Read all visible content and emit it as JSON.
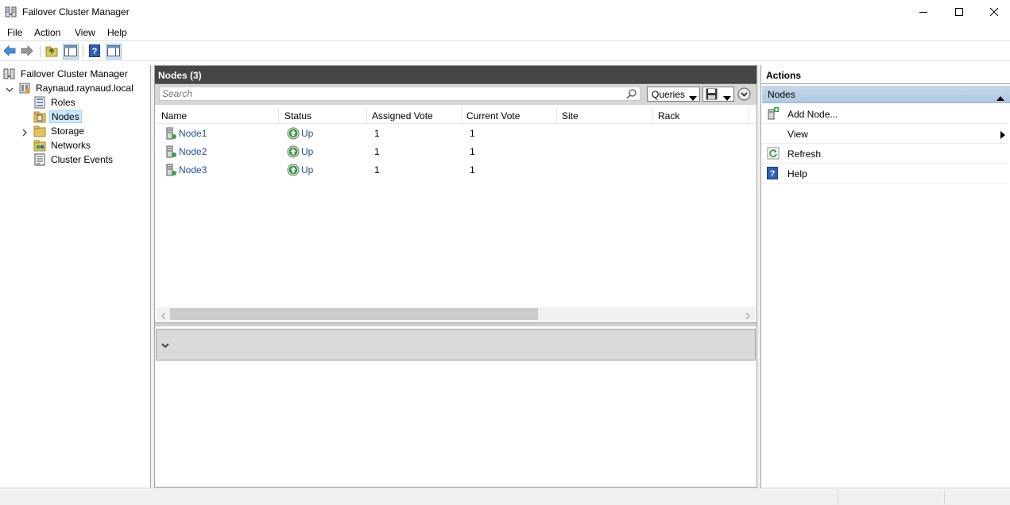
{
  "window": {
    "title": "Failover Cluster Manager",
    "controls": [
      "minimize-icon",
      "maximize-icon",
      "close-icon"
    ]
  },
  "menu": [
    "File",
    "Action",
    "View",
    "Help"
  ],
  "toolbar": {
    "buttons": [
      "back-arrow-icon",
      "forward-arrow-icon",
      "up-folder-icon",
      "show-hide-console-tree-icon",
      "help-icon",
      "show-hide-action-pane-icon"
    ]
  },
  "tree": {
    "root": "Failover Cluster Manager",
    "cluster": "Raynaud.raynaud.local",
    "children": [
      "Roles",
      "Nodes",
      "Storage",
      "Networks",
      "Cluster Events"
    ],
    "selected": "Nodes"
  },
  "center": {
    "title": "Nodes (3)",
    "search_placeholder": "Search",
    "queries_label": "Queries",
    "columns": [
      "Name",
      "Status",
      "Assigned Vote",
      "Current Vote",
      "Site",
      "Rack"
    ],
    "rows": [
      {
        "name": "Node1",
        "status": "Up",
        "assigned_vote": "1",
        "current_vote": "1",
        "site": "",
        "rack": ""
      },
      {
        "name": "Node2",
        "status": "Up",
        "assigned_vote": "1",
        "current_vote": "1",
        "site": "",
        "rack": ""
      },
      {
        "name": "Node3",
        "status": "Up",
        "assigned_vote": "1",
        "current_vote": "1",
        "site": "",
        "rack": ""
      }
    ]
  },
  "actions": {
    "header": "Actions",
    "section": "Nodes",
    "items": [
      {
        "label": "Add Node...",
        "icon": "add-node-icon"
      },
      {
        "label": "View",
        "icon": "",
        "submenu": true
      },
      {
        "label": "Refresh",
        "icon": "refresh-icon"
      },
      {
        "label": "Help",
        "icon": "help-icon"
      }
    ]
  },
  "colors": {
    "header_dark": "#464646",
    "selection": "#cce8ff",
    "action_section": "#b8cde6",
    "link": "#1e4e9c",
    "status_up": "#2e9e3e"
  }
}
